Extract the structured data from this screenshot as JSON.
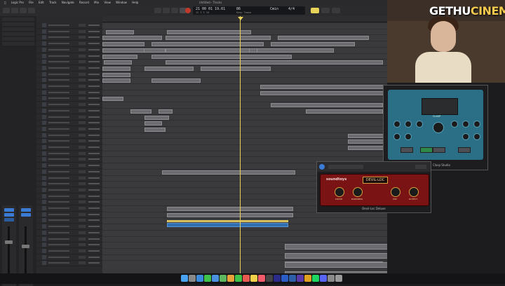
{
  "menubar": {
    "apple": "",
    "app": "Logic Pro",
    "items": [
      "File",
      "Edit",
      "Track",
      "Navigate",
      "Record",
      "Mix",
      "View",
      "Window",
      "Help"
    ],
    "project_title": "Untitled - Tracks"
  },
  "lcd": {
    "bars": "21 00 01 19.61",
    "beats": "12 3 3 10",
    "tempo": "86",
    "tempo_mode": "Keep Tempo",
    "key": "Cmin",
    "time_sig": "4/4"
  },
  "webcam": {
    "logo_prefix": "GETHU",
    "logo_accent": "CINEMA"
  },
  "plugins": {
    "clasp": {
      "display_label": "CLASP",
      "footer": "Clasp Studio"
    },
    "devil_loc": {
      "brand": "soundtoys",
      "title": "DEVIL-LOC",
      "knob_labels": [
        "CRUSH",
        "DARKNESS",
        "MIX",
        "OUTPUT"
      ],
      "footer": "Devil-Loc Deluxe"
    }
  },
  "colors": {
    "accent_yellow": "#e8d35a",
    "region_blue": "#2f6fb0",
    "devil_red": "#7a1414",
    "clasp_teal": "#2a6f86"
  },
  "dock_icons": [
    "finder-icon",
    "launchpad-icon",
    "safari-icon",
    "messages-icon",
    "mail-icon",
    "maps-icon",
    "photos-icon",
    "facetime-icon",
    "calendar-icon",
    "notes-icon",
    "music-icon",
    "logic-icon",
    "premiere-icon",
    "photoshop-icon",
    "lightroom-icon",
    "ae-icon",
    "chrome-icon",
    "spotify-icon",
    "discord-icon",
    "settings-icon",
    "trash-icon"
  ]
}
